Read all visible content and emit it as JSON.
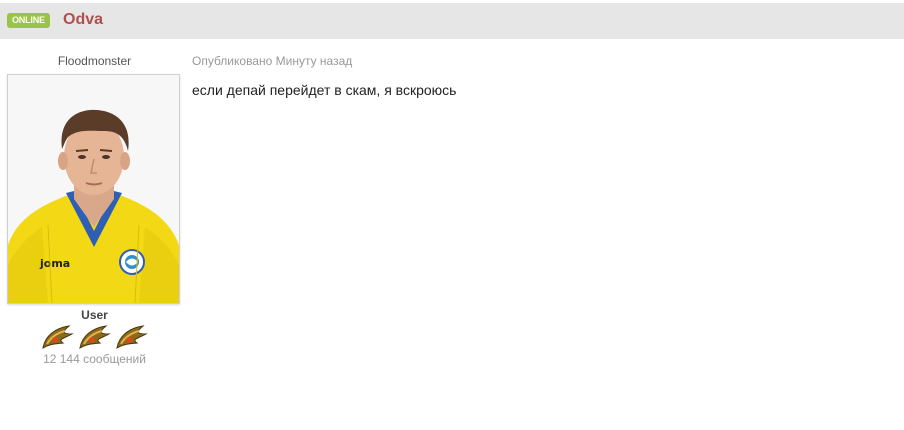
{
  "header": {
    "status_badge": "ONLINE",
    "author_name": "Odva"
  },
  "user": {
    "title": "Floodmonster",
    "avatar": "player-photo",
    "group": "User",
    "rank_icons": [
      "rank-wing-icon",
      "rank-wing-icon",
      "rank-wing-icon"
    ],
    "post_count": "12 144 сообщений"
  },
  "post": {
    "meta": "Опубликовано Минуту назад",
    "text": "если депай перейдет в скам, я вскроюсь"
  },
  "colors": {
    "badge": "#9ac349",
    "author_name": "#b0504e",
    "header_bg": "#e6e6e6"
  }
}
